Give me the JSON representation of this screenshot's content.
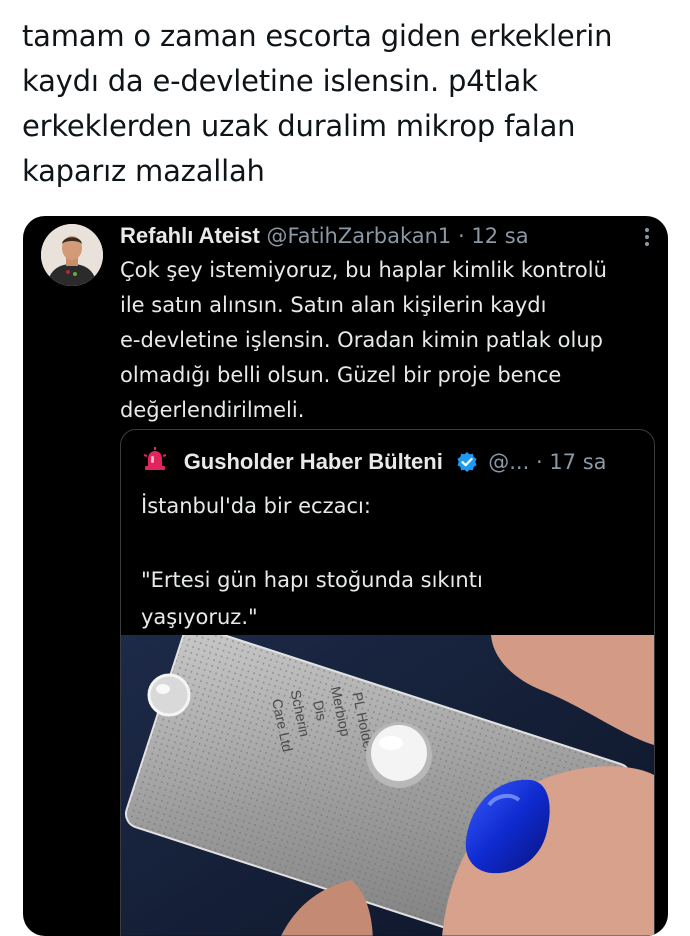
{
  "post": {
    "lines": [
      "tamam o zaman escorta giden erkeklerin",
      "kaydı da e-devletine islensin. p4tlak",
      "erkeklerden uzak duralim mikrop falan",
      "kaparız mazallah"
    ]
  },
  "embedded_tweet": {
    "author_name": "Refahlı Ateist",
    "handle": "@FatihZarbakan1",
    "separator": "·",
    "time": "12 sa",
    "more_icon": "more-vertical-icon",
    "text_lines": [
      "Çok şey istemiyoruz, bu haplar kimlik kontrolü",
      "ile satın alınsın. Satın alan kişilerin kaydı",
      "e-devletine işlensin. Oradan kimin patlak olup",
      "olmadığı belli olsun. Güzel bir proje bence",
      "değerlendirilmeli."
    ]
  },
  "quoted_tweet": {
    "author_name": "Gusholder Haber Bülteni",
    "handle": "@...",
    "separator": "·",
    "time": "17 sa",
    "avatar_icon": "bell-siren-icon",
    "verified_icon": "verified-badge-icon",
    "text_lines": [
      "İstanbul'da bir eczacı:",
      "",
      "\"Ertesi gün hapı stoğunda sıkıntı",
      "yaşıyoruz.\""
    ],
    "image": {
      "description_icon": "pill-blister-photo",
      "pack_text": [
        "PL Holder",
        "Merbiop",
        "Dis",
        "Scherin",
        "Care Ltd"
      ]
    }
  },
  "colors": {
    "page_bg": "#ffffff",
    "card_bg": "#000000",
    "primary_text": "#e7e9ea",
    "secondary_text": "#8b98a5",
    "verified": "#1d9bf0",
    "alert_red": "#e0245e"
  }
}
